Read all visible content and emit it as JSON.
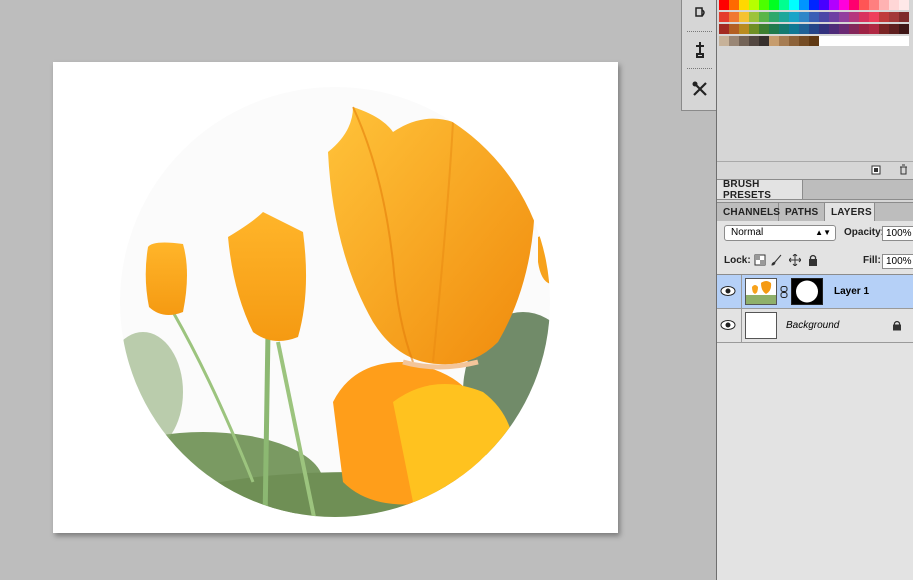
{
  "document": {
    "layer_content": "tulip photo masked to circle"
  },
  "toolstrip": {
    "tools": [
      "history-brush-icon",
      "clone-source-icon",
      "tool-presets-icon"
    ]
  },
  "swatches": {
    "rows": [
      [
        "#ff0000",
        "#ff6a00",
        "#ffd800",
        "#b6ff00",
        "#4cff00",
        "#00ff21",
        "#00ff90",
        "#00ffff",
        "#0094ff",
        "#0026ff",
        "#4800ff",
        "#b200ff",
        "#ff00dc",
        "#ff006e",
        "#ff5555",
        "#ff7f7f",
        "#ffb2b2",
        "#ffd6d6",
        "#ffe8e8"
      ],
      [
        "#e53c2d",
        "#f07830",
        "#f5c233",
        "#9dc33a",
        "#5ab548",
        "#2ea86b",
        "#1ea79a",
        "#19a4c8",
        "#2f86c8",
        "#3a5fb5",
        "#4a47a7",
        "#6e3fa3",
        "#923f9e",
        "#b5377d",
        "#d9325e",
        "#ef3e5b",
        "#c03b3b",
        "#a33838",
        "#7f2b2b"
      ],
      [
        "#a32a21",
        "#b35f22",
        "#b98b20",
        "#6f8f25",
        "#3d7f30",
        "#1f7a4c",
        "#137a70",
        "#0f7894",
        "#1f6196",
        "#254589",
        "#32317d",
        "#4e2b79",
        "#6a2a74",
        "#84265a",
        "#9e2244",
        "#b02843",
        "#7a2424",
        "#5f1f1f",
        "#3e1616"
      ],
      [
        "#c7b299",
        "#998675",
        "#736357",
        "#534741",
        "#37302d",
        "#c69c6d",
        "#a67c52",
        "#8c6239",
        "#754c24",
        "#603913",
        "#ffffff",
        "#ffffff",
        "#ffffff",
        "#ffffff",
        "#ffffff",
        "#ffffff",
        "#ffffff",
        "#ffffff",
        "#ffffff"
      ]
    ]
  },
  "brush_presets_tab": "BRUSH PRESETS",
  "tabs": [
    {
      "label": "CHANNELS",
      "active": false
    },
    {
      "label": "PATHS",
      "active": false
    },
    {
      "label": "LAYERS",
      "active": true
    }
  ],
  "layers_panel": {
    "blend_mode": "Normal",
    "opacity_label": "Opacity:",
    "opacity_value": "100%",
    "lock_label": "Lock:",
    "fill_label": "Fill:",
    "fill_value": "100%",
    "layers": [
      {
        "name": "Layer 1",
        "visible": true,
        "selected": true,
        "has_mask": true,
        "locked": false
      },
      {
        "name": "Background",
        "visible": true,
        "selected": false,
        "has_mask": false,
        "locked": true
      }
    ]
  },
  "colors": {
    "workspace_bg": "#bdbdbd",
    "panel_bg": "#d6d6d6",
    "selected_layer": "#b5d0f7",
    "tulip_orange": "#f7a21b"
  }
}
